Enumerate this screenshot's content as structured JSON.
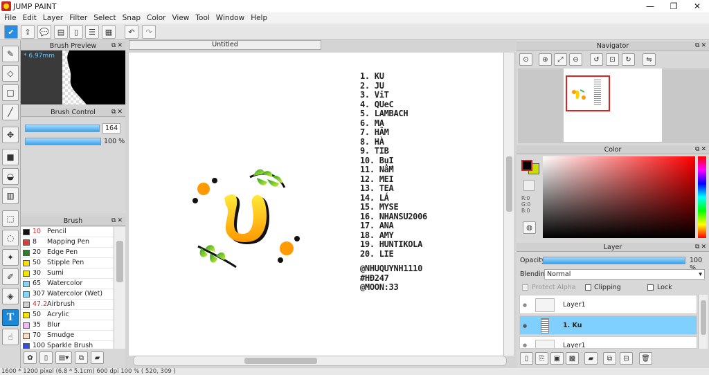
{
  "app": {
    "title": "JUMP PAINT"
  },
  "menu": [
    "File",
    "Edit",
    "Layer",
    "Filter",
    "Select",
    "Snap",
    "Color",
    "View",
    "Tool",
    "Window",
    "Help"
  ],
  "window_controls": {
    "minimize": "—",
    "restore": "❐",
    "close": "✕"
  },
  "panels": {
    "brush_preview": {
      "title": "Brush Preview",
      "size": "* 6.97mm"
    },
    "brush_control": {
      "title": "Brush Control",
      "size_value": "164",
      "opacity_value": "100 %"
    },
    "brush": {
      "title": "Brush",
      "items": [
        {
          "size": "10",
          "name": "Pencil",
          "color": "#111111",
          "size_color": "#d32f2f"
        },
        {
          "size": "8",
          "name": "Mapping Pen",
          "color": "#e53935",
          "size_color": "#222"
        },
        {
          "size": "20",
          "name": "Edge Pen",
          "color": "#2e7d32",
          "size_color": "#222"
        },
        {
          "size": "50",
          "name": "Stipple Pen",
          "color": "#f9e000",
          "size_color": "#222"
        },
        {
          "size": "30",
          "name": "Sumi",
          "color": "#f5e600",
          "size_color": "#222"
        },
        {
          "size": "65",
          "name": "Watercolor",
          "color": "#80d8ff",
          "size_color": "#222"
        },
        {
          "size": "307",
          "name": "Watercolor (Wet)",
          "color": "#80d8ff",
          "size_color": "#222"
        },
        {
          "size": "47.2",
          "name": "Airbrush",
          "color": "#d0d0d0",
          "size_color": "#d32f2f"
        },
        {
          "size": "50",
          "name": "Acrylic",
          "color": "#f5e600",
          "size_color": "#222"
        },
        {
          "size": "35",
          "name": "Blur",
          "color": "#f8b4f8",
          "size_color": "#222"
        },
        {
          "size": "70",
          "name": "Smudge",
          "color": "#fde0c0",
          "size_color": "#222"
        },
        {
          "size": "100",
          "name": "Sparkle Brush",
          "color": "#3050e0",
          "size_color": "#222"
        }
      ]
    },
    "canvas": {
      "tab_title": "Untitled"
    },
    "navigator": {
      "title": "Navigator"
    },
    "color": {
      "title": "Color",
      "r": "R:0",
      "g": "G:0",
      "b": "B:0"
    },
    "layer": {
      "title": "Layer",
      "opacity_label": "Opacity",
      "opacity_value": "100 %",
      "blending_label": "Blending",
      "blending_value": "Normal",
      "protect_alpha": "Protect Alpha",
      "clipping": "Clipping",
      "lock": "Lock",
      "rows": [
        {
          "name": "Layer1",
          "selected": false
        },
        {
          "name": "1. Ku",
          "selected": true
        },
        {
          "name": "Layer1",
          "selected": false
        }
      ]
    }
  },
  "canvas_text": {
    "list": [
      "1. KU",
      "2. JU",
      "3. ViT",
      "4. QUeC",
      "5. LAMBACH",
      "6. MA",
      "7. HÂM",
      "8. HÀ",
      "9. TIB",
      "10. BụI",
      "11. NấM",
      "12. MEI",
      "13. TEA",
      "14. LÁ",
      "15. MYSE",
      "16. NHANSU2006",
      "17. ANA",
      "18. AMY",
      "19. HUNTIKOLA",
      "20. LIE"
    ],
    "tags": [
      "@NHUQUYNH1110",
      "#HĐ247",
      "@MOON:33"
    ]
  },
  "status": "1600 * 1200 pixel  (6.8 * 5.1cm)  600 dpi  100 %  ( 520, 309 )",
  "colors": {
    "accent": "#1a87d8",
    "selected_row": "#7fd0ff",
    "fg_color": "#000000",
    "bg_color": "#c8e000"
  },
  "icons": {
    "toolbar": [
      "check-icon",
      "export-icon",
      "speech-icon",
      "comment-icon",
      "page-icon",
      "list-icon",
      "grid-check-icon",
      "undo-icon",
      "redo-icon"
    ],
    "tools": [
      "pen-icon",
      "eraser-icon",
      "rect-icon",
      "line-icon",
      "move-icon",
      "fill-rect-icon",
      "bucket-icon",
      "gradient-icon",
      "select-rect-icon",
      "lasso-icon",
      "wand-icon",
      "select-pen-icon",
      "select-eraser-icon",
      "text-icon",
      "hand-icon"
    ]
  }
}
